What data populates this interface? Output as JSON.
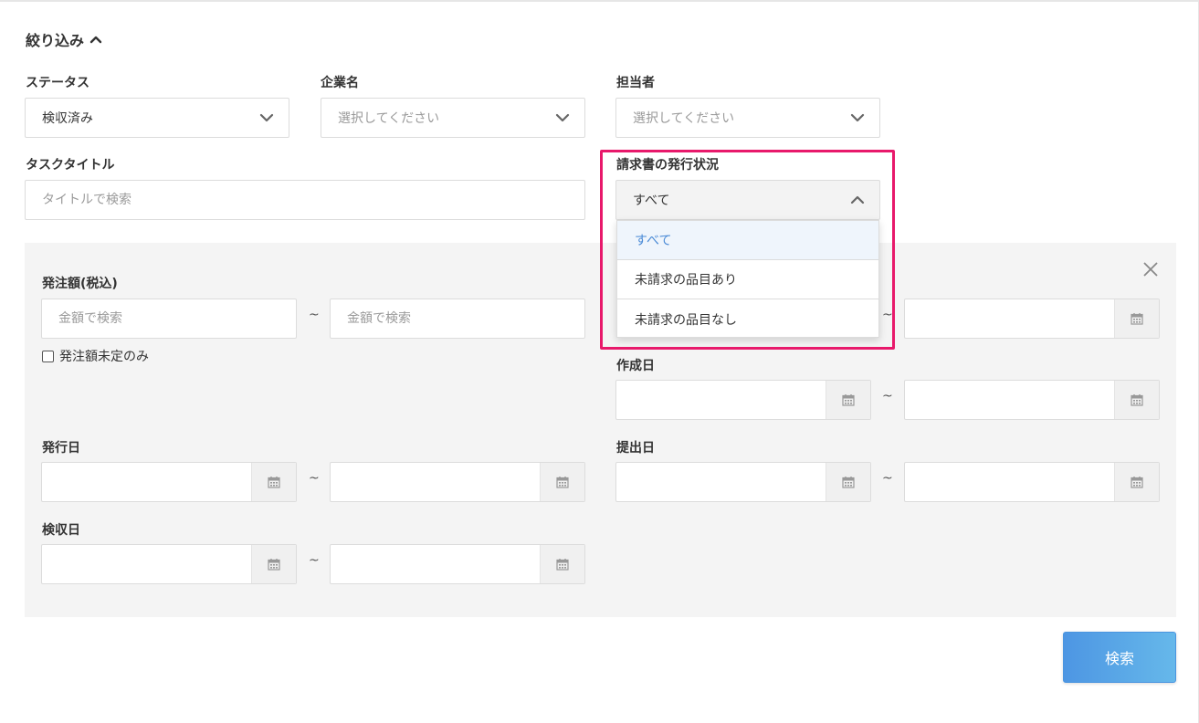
{
  "filter": {
    "title": "絞り込み"
  },
  "status": {
    "label": "ステータス",
    "value": "検収済み"
  },
  "company": {
    "label": "企業名",
    "placeholder": "選択してください"
  },
  "assignee": {
    "label": "担当者",
    "placeholder": "選択してください"
  },
  "task_title": {
    "label": "タスクタイトル",
    "placeholder": "タイトルで検索"
  },
  "invoice_status": {
    "label": "請求書の発行状況",
    "value": "すべて",
    "options": [
      "すべて",
      "未請求の品目あり",
      "未請求の品目なし"
    ]
  },
  "order_amount": {
    "label": "発注額(税込)",
    "min_placeholder": "金額で検索",
    "max_placeholder": "金額で検索",
    "checkbox_label": "発注額未定のみ"
  },
  "range_separator": "~",
  "created_date": {
    "label": "作成日"
  },
  "issue_date": {
    "label": "発行日"
  },
  "submit_date": {
    "label": "提出日"
  },
  "acceptance_date": {
    "label": "検収日"
  },
  "search_button": {
    "label": "検索"
  },
  "colors": {
    "highlight": "#e8196b",
    "accent": "#4a8ad6",
    "panel": "#f4f4f4"
  },
  "icons": {
    "collapse": "chevron-up-icon",
    "select": "chevron-down-icon",
    "close": "close-icon",
    "date": "calendar-icon"
  }
}
